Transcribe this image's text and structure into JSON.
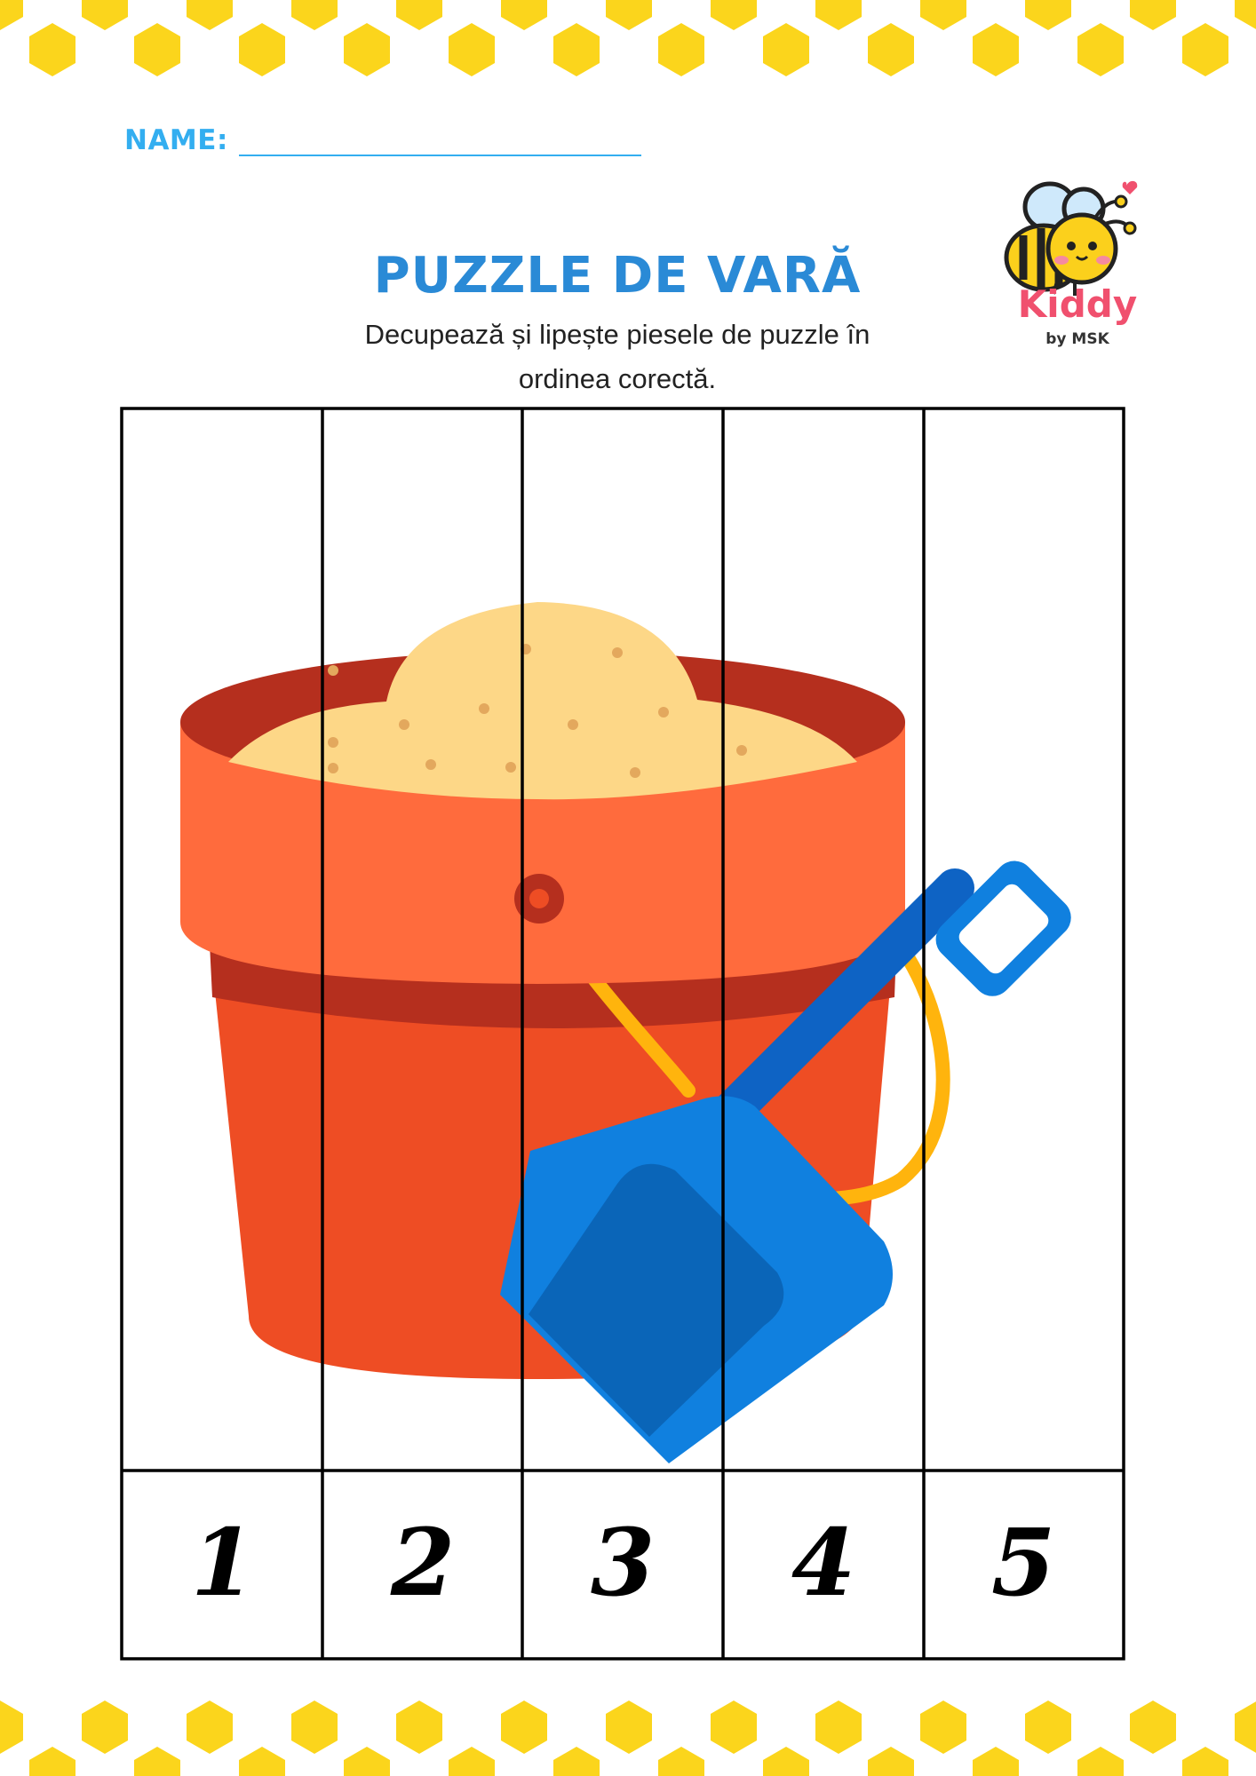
{
  "header": {
    "name_label": "NAME:",
    "title": "PUZZLE DE VARĂ",
    "instructions_line1": "Decupează și lipește piesele de puzzle în",
    "instructions_line2": "ordinea corectă."
  },
  "logo": {
    "brand": "Kiddy",
    "sub": "by MSK",
    "icon": "bee-icon"
  },
  "puzzle": {
    "numbers": [
      "1",
      "2",
      "3",
      "4",
      "5"
    ],
    "image": "sand-bucket-and-shovel"
  },
  "colors": {
    "honeycomb": "#fbd51c",
    "accent_blue": "#33aef0",
    "title_blue": "#2a8ad6",
    "brand_pink": "#f0506e",
    "bucket_orange": "#ff6b3d",
    "shovel_blue": "#1080df",
    "sand": "#fdd787"
  }
}
